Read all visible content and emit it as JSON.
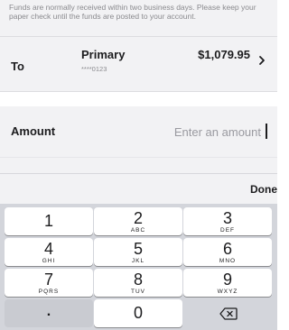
{
  "notice": {
    "text": "Funds are normally received within two business days. Please keep your paper check until the funds are posted to your account."
  },
  "to_row": {
    "label": "To",
    "account_name": "Primary",
    "account_number": "****0123",
    "balance": "$1,079.95",
    "chevron_icon": "chevron-right-icon"
  },
  "amount": {
    "label": "Amount",
    "value": "",
    "placeholder": "Enter an amount"
  },
  "toolbar": {
    "done_label": "Done"
  },
  "keypad": {
    "keys": [
      {
        "digit": "1",
        "letters": ""
      },
      {
        "digit": "2",
        "letters": "ABC"
      },
      {
        "digit": "3",
        "letters": "DEF"
      },
      {
        "digit": "4",
        "letters": "GHI"
      },
      {
        "digit": "5",
        "letters": "JKL"
      },
      {
        "digit": "6",
        "letters": "MNO"
      },
      {
        "digit": "7",
        "letters": "PQRS"
      },
      {
        "digit": "8",
        "letters": "TUV"
      },
      {
        "digit": "9",
        "letters": "WXYZ"
      }
    ],
    "decimal": ".",
    "zero": "0",
    "delete_icon": "backspace-icon"
  },
  "colors": {
    "panel_background": "#f2f2f4",
    "keypad_background": "#d3d5db",
    "key_background": "#ffffff",
    "text": "#1c1c1e",
    "muted_text": "#8a8a8e"
  }
}
